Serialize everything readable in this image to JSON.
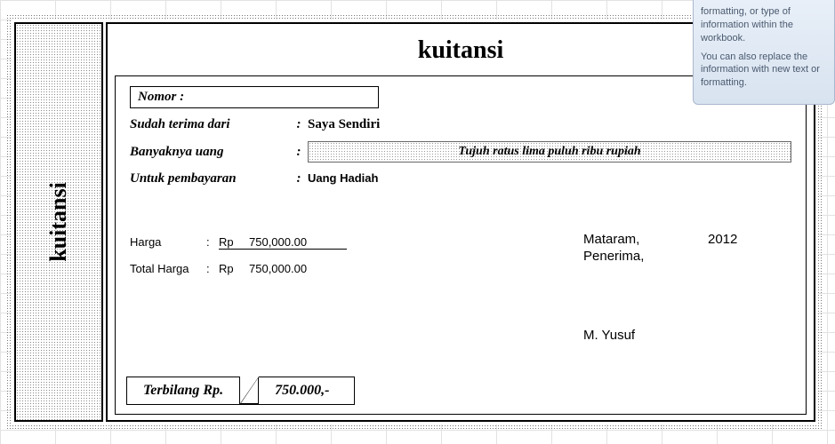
{
  "tooltip": {
    "line1": "formatting, or type of information within the workbook.",
    "line2": "You can also replace the information with new text or formatting."
  },
  "receipt": {
    "title": "kuitansi",
    "stub_label": "kuitansi",
    "fields": {
      "nomor_label": "Nomor :",
      "nomor_value": "",
      "dari_label": "Sudah terima dari",
      "dari_value": "Saya Sendiri",
      "banyak_label": "Banyaknya uang",
      "banyak_value": "Tujuh ratus lima puluh  ribu rupiah",
      "untuk_label": "Untuk pembayaran",
      "untuk_value": "Uang Hadiah"
    },
    "prices": {
      "harga_label": "Harga",
      "harga_currency": "Rp",
      "harga_value": "750,000.00",
      "total_label": "Total Harga",
      "total_currency": "Rp",
      "total_value": "750,000.00"
    },
    "signature": {
      "city": "Mataram,",
      "year": "2012",
      "receiver_label": "Penerima,",
      "name": "M. Yusuf"
    },
    "terbilang": {
      "label": "Terbilang  Rp.",
      "value": "750.000,-"
    }
  }
}
